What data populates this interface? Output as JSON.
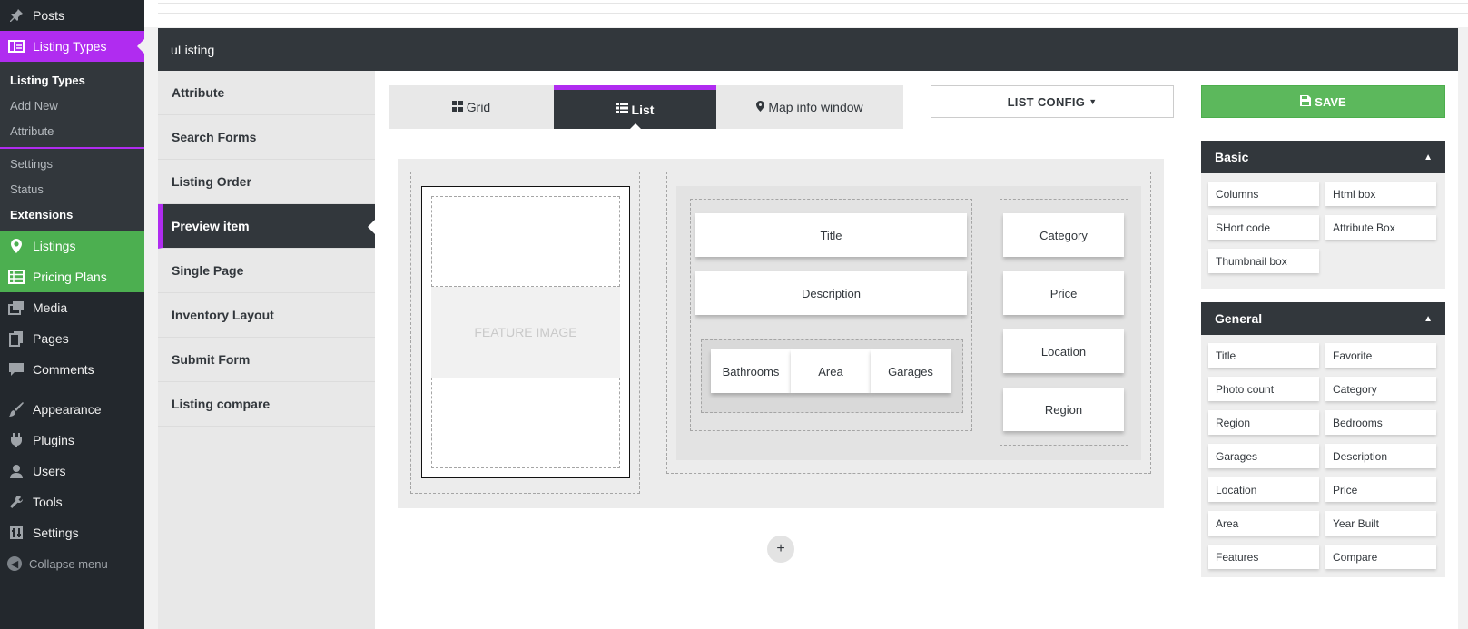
{
  "wp_menu": {
    "posts": "Posts",
    "listing_types": "Listing Types",
    "sub": [
      "Listing Types",
      "Add New",
      "Attribute"
    ],
    "settings_sub": [
      "Settings",
      "Status",
      "Extensions"
    ],
    "listings": "Listings",
    "pricing_plans": "Pricing Plans",
    "media": "Media",
    "pages": "Pages",
    "comments": "Comments",
    "appearance": "Appearance",
    "plugins": "Plugins",
    "users": "Users",
    "tools": "Tools",
    "settings": "Settings",
    "collapse": "Collapse menu"
  },
  "app": {
    "title": "uListing"
  },
  "side_nav": [
    "Attribute",
    "Search Forms",
    "Listing Order",
    "Preview item",
    "Single Page",
    "Inventory Layout",
    "Submit Form",
    "Listing compare"
  ],
  "view_tabs": {
    "grid": "Grid",
    "list": "List",
    "map": "Map info window"
  },
  "list_config": "LIST CONFIG",
  "save": "SAVE",
  "builder": {
    "feature_image": "FEATURE IMAGE",
    "title": "Title",
    "description": "Description",
    "bathrooms": "Bathrooms",
    "area": "Area",
    "garages": "Garages",
    "category": "Category",
    "price": "Price",
    "location": "Location",
    "region": "Region",
    "add": "+"
  },
  "palettes": {
    "basic": {
      "title": "Basic",
      "items": [
        "Columns",
        "Html box",
        "SHort code",
        "Attribute Box",
        "Thumbnail box"
      ]
    },
    "general": {
      "title": "General",
      "items": [
        "Title",
        "Favorite",
        "Photo count",
        "Category",
        "Region",
        "Bedrooms",
        "Garages",
        "Description",
        "Location",
        "Price",
        "Area",
        "Year Built",
        "Features",
        "Compare"
      ]
    }
  },
  "colors": {
    "accent": "#b02cf0",
    "dark": "#32373c",
    "wp_sidebar": "#23282d",
    "green": "#4caf50",
    "save": "#5cb85c"
  }
}
